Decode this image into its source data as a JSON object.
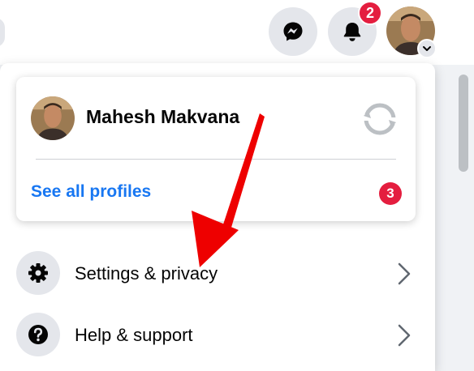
{
  "header": {
    "notification_count": "2"
  },
  "profile_card": {
    "name": "Mahesh Makvana",
    "see_all_label": "See all profiles",
    "profiles_badge": "3"
  },
  "menu": {
    "items": [
      {
        "label": "Settings & privacy",
        "icon": "gear-icon"
      },
      {
        "label": "Help & support",
        "icon": "question-icon"
      }
    ]
  },
  "colors": {
    "accent": "#1877f2",
    "badge": "#e41e3f",
    "annotation_arrow": "#ee0000"
  }
}
